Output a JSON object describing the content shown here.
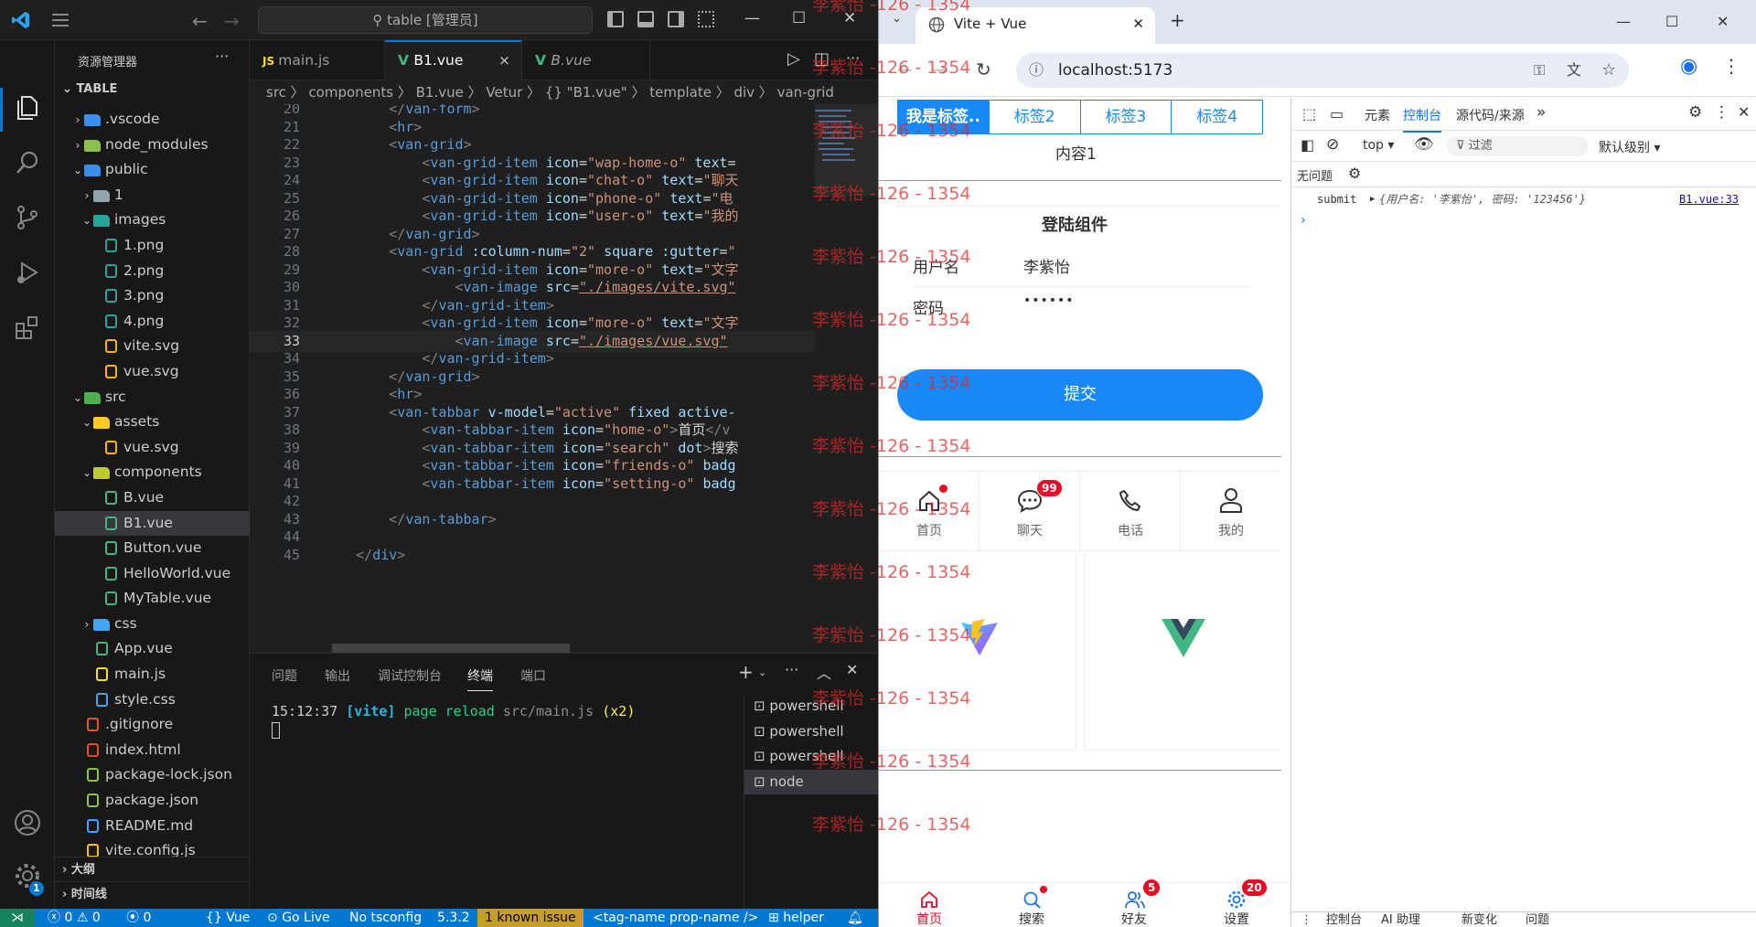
{
  "vscode": {
    "search": "table [管理员]",
    "sidebar": {
      "title": "资源管理器",
      "root": "TABLE",
      "tree": [
        {
          "label": ".vscode",
          "depth": 0,
          "type": "folder",
          "open": false,
          "icon": "vscode-folder-icon",
          "color": "#3b8eea"
        },
        {
          "label": "node_modules",
          "depth": 0,
          "type": "folder",
          "open": false,
          "icon": "node-folder-icon",
          "color": "#8bc34a"
        },
        {
          "label": "public",
          "depth": 0,
          "type": "folder",
          "open": true,
          "icon": "public-folder-icon",
          "color": "#3b8eea"
        },
        {
          "label": "1",
          "depth": 1,
          "type": "folder",
          "open": false,
          "icon": "folder-icon",
          "color": "#90a4ae"
        },
        {
          "label": "images",
          "depth": 1,
          "type": "folder",
          "open": true,
          "icon": "images-folder-icon",
          "color": "#26a69a"
        },
        {
          "label": "1.png",
          "depth": 2,
          "type": "file",
          "icon": "image-file-icon",
          "color": "#26a69a"
        },
        {
          "label": "2.png",
          "depth": 2,
          "type": "file",
          "icon": "image-file-icon",
          "color": "#26a69a"
        },
        {
          "label": "3.png",
          "depth": 2,
          "type": "file",
          "icon": "image-file-icon",
          "color": "#26a69a"
        },
        {
          "label": "4.png",
          "depth": 2,
          "type": "file",
          "icon": "image-file-icon",
          "color": "#26a69a"
        },
        {
          "label": "vite.svg",
          "depth": 2,
          "type": "file",
          "icon": "svg-file-icon",
          "color": "#ffb300"
        },
        {
          "label": "vue.svg",
          "depth": 2,
          "type": "file",
          "icon": "svg-file-icon",
          "color": "#ffb300"
        },
        {
          "label": "src",
          "depth": 0,
          "type": "folder",
          "open": true,
          "icon": "src-folder-icon",
          "color": "#4caf50"
        },
        {
          "label": "assets",
          "depth": 1,
          "type": "folder",
          "open": true,
          "icon": "assets-folder-icon",
          "color": "#ffca28"
        },
        {
          "label": "vue.svg",
          "depth": 2,
          "type": "file",
          "icon": "svg-file-icon",
          "color": "#ffb300"
        },
        {
          "label": "components",
          "depth": 1,
          "type": "folder",
          "open": true,
          "icon": "components-folder-icon",
          "color": "#c0ca33"
        },
        {
          "label": "B.vue",
          "depth": 2,
          "type": "file",
          "icon": "vue-file-icon",
          "color": "#41b883"
        },
        {
          "label": "B1.vue",
          "depth": 2,
          "type": "file",
          "icon": "vue-file-icon",
          "color": "#41b883",
          "selected": true
        },
        {
          "label": "Button.vue",
          "depth": 2,
          "type": "file",
          "icon": "vue-file-icon",
          "color": "#41b883"
        },
        {
          "label": "HelloWorld.vue",
          "depth": 2,
          "type": "file",
          "icon": "vue-file-icon",
          "color": "#41b883"
        },
        {
          "label": "MyTable.vue",
          "depth": 2,
          "type": "file",
          "icon": "vue-file-icon",
          "color": "#41b883"
        },
        {
          "label": "css",
          "depth": 1,
          "type": "folder",
          "open": false,
          "icon": "css-folder-icon",
          "color": "#42a5f5"
        },
        {
          "label": "App.vue",
          "depth": 1,
          "type": "file",
          "icon": "vue-file-icon",
          "color": "#41b883"
        },
        {
          "label": "main.js",
          "depth": 1,
          "type": "file",
          "icon": "js-file-icon",
          "color": "#f7df1e"
        },
        {
          "label": "style.css",
          "depth": 1,
          "type": "file",
          "icon": "css-file-icon",
          "color": "#42a5f5"
        },
        {
          "label": ".gitignore",
          "depth": 0,
          "type": "file",
          "icon": "git-file-icon",
          "color": "#f4511e"
        },
        {
          "label": "index.html",
          "depth": 0,
          "type": "file",
          "icon": "html-file-icon",
          "color": "#e44d26"
        },
        {
          "label": "package-lock.json",
          "depth": 0,
          "type": "file",
          "icon": "node-file-icon",
          "color": "#8bc34a"
        },
        {
          "label": "package.json",
          "depth": 0,
          "type": "file",
          "icon": "node-file-icon",
          "color": "#8bc34a"
        },
        {
          "label": "README.md",
          "depth": 0,
          "type": "file",
          "icon": "info-file-icon",
          "color": "#42a5f5"
        },
        {
          "label": "vite.config.js",
          "depth": 0,
          "type": "file",
          "icon": "vite-file-icon",
          "color": "#ffc107"
        }
      ],
      "outline": "大纲",
      "timeline": "时间线"
    },
    "tabs": [
      {
        "label": "main.js",
        "icon": "js-file-icon",
        "italic": false
      },
      {
        "label": "B1.vue",
        "icon": "vue-file-icon",
        "italic": false,
        "active": true,
        "close": "×"
      },
      {
        "label": "B.vue",
        "icon": "vue-file-icon",
        "italic": true
      }
    ],
    "breadcrumb": "src 〉 components 〉 B1.vue 〉 Vetur 〉 {} \"B1.vue\" 〉 template 〉 div 〉 van-grid",
    "code_lines": [
      {
        "n": "20",
        "html": "        <span class='br'>&lt;/</span><span class='tg'>van-form</span><span class='br'>&gt;</span>"
      },
      {
        "n": "21",
        "html": "        <span class='br'>&lt;</span><span class='tg'>hr</span><span class='br'>&gt;</span>"
      },
      {
        "n": "22",
        "html": "        <span class='br'>&lt;</span><span class='tg'>van-grid</span><span class='br'>&gt;</span>"
      },
      {
        "n": "23",
        "html": "            <span class='br'>&lt;</span><span class='tg'>van-grid-item</span> <span class='at'>icon</span><span class='tx'>=</span><span class='st'>\"wap-home-o\"</span> <span class='at'>text</span><span class='tx'>=</span>"
      },
      {
        "n": "24",
        "html": "            <span class='br'>&lt;</span><span class='tg'>van-grid-item</span> <span class='at'>icon</span><span class='tx'>=</span><span class='st'>\"chat-o\"</span> <span class='at'>text</span><span class='tx'>=</span><span class='st'>\"聊天</span>"
      },
      {
        "n": "25",
        "html": "            <span class='br'>&lt;</span><span class='tg'>van-grid-item</span> <span class='at'>icon</span><span class='tx'>=</span><span class='st'>\"phone-o\"</span> <span class='at'>text</span><span class='tx'>=</span><span class='st'>\"电</span>"
      },
      {
        "n": "26",
        "html": "            <span class='br'>&lt;</span><span class='tg'>van-grid-item</span> <span class='at'>icon</span><span class='tx'>=</span><span class='st'>\"user-o\"</span> <span class='at'>text</span><span class='tx'>=</span><span class='st'>\"我的</span>"
      },
      {
        "n": "27",
        "html": "        <span class='br'>&lt;/</span><span class='tg'>van-grid</span><span class='br'>&gt;</span>"
      },
      {
        "n": "28",
        "html": "        <span class='br'>&lt;</span><span class='tg'>van-grid</span> <span class='at'>:column-num</span><span class='tx'>=</span><span class='st'>\"2\"</span> <span class='at'>square</span> <span class='at'>:gutter</span><span class='tx'>=</span><span class='st'>\"</span>"
      },
      {
        "n": "29",
        "html": "            <span class='br'>&lt;</span><span class='tg'>van-grid-item</span> <span class='at'>icon</span><span class='tx'>=</span><span class='st'>\"more-o\"</span> <span class='at'>text</span><span class='tx'>=</span><span class='st'>\"文字</span>"
      },
      {
        "n": "30",
        "html": "                <span class='br'>&lt;</span><span class='tg'>van-image</span> <span class='at'>src</span><span class='tx'>=</span><span class='st un'>\"./images/vite.svg\"</span>"
      },
      {
        "n": "31",
        "html": "            <span class='br'>&lt;/</span><span class='tg'>van-grid-item</span><span class='br'>&gt;</span>"
      },
      {
        "n": "32",
        "html": "            <span class='br'>&lt;</span><span class='tg'>van-grid-item</span> <span class='at'>icon</span><span class='tx'>=</span><span class='st'>\"more-o\"</span> <span class='at'>text</span><span class='tx'>=</span><span class='st'>\"文字</span>"
      },
      {
        "n": "33",
        "html": "                <span class='br'>&lt;</span><span class='tg'>van-image</span> <span class='at'>src</span><span class='tx'>=</span><span class='st un'>\"./images/vue.svg\"</span>",
        "cur": true
      },
      {
        "n": "34",
        "html": "            <span class='br'>&lt;/</span><span class='tg'>van-grid-item</span><span class='br'>&gt;</span>"
      },
      {
        "n": "35",
        "html": "        <span class='br'>&lt;/</span><span class='tg'>van-grid</span><span class='br'>&gt;</span>"
      },
      {
        "n": "36",
        "html": "        <span class='br'>&lt;</span><span class='tg'>hr</span><span class='br'>&gt;</span>"
      },
      {
        "n": "37",
        "html": "        <span class='br'>&lt;</span><span class='tg'>van-tabbar</span> <span class='at'>v-model</span><span class='tx'>=</span><span class='st'>\"active\"</span> <span class='at'>fixed</span> <span class='at'>active-</span>"
      },
      {
        "n": "38",
        "html": "            <span class='br'>&lt;</span><span class='tg'>van-tabbar-item</span> <span class='at'>icon</span><span class='tx'>=</span><span class='st'>\"home-o\"</span><span class='br'>&gt;</span><span class='tx'>首页</span><span class='br'>&lt;/v</span>"
      },
      {
        "n": "39",
        "html": "            <span class='br'>&lt;</span><span class='tg'>van-tabbar-item</span> <span class='at'>icon</span><span class='tx'>=</span><span class='st'>\"search\"</span> <span class='at'>dot</span><span class='br'>&gt;</span><span class='tx'>搜索</span>"
      },
      {
        "n": "40",
        "html": "            <span class='br'>&lt;</span><span class='tg'>van-tabbar-item</span> <span class='at'>icon</span><span class='tx'>=</span><span class='st'>\"friends-o\"</span> <span class='at'>badg</span>"
      },
      {
        "n": "41",
        "html": "            <span class='br'>&lt;</span><span class='tg'>van-tabbar-item</span> <span class='at'>icon</span><span class='tx'>=</span><span class='st'>\"setting-o\"</span> <span class='at'>badg</span>"
      },
      {
        "n": "42",
        "html": ""
      },
      {
        "n": "43",
        "html": "        <span class='br'>&lt;/</span><span class='tg'>van-tabbar</span><span class='br'>&gt;</span>"
      },
      {
        "n": "44",
        "html": ""
      },
      {
        "n": "45",
        "html": "    <span class='br'>&lt;/</span><span class='tg'>div</span><span class='br'>&gt;</span>"
      }
    ],
    "panel": {
      "tabs": [
        "问题",
        "输出",
        "调试控制台",
        "终端",
        "端口"
      ],
      "active_tab": "终端",
      "terminal_time": "15:12:37",
      "terminal_tag": "[vite]",
      "terminal_msg": "page reload",
      "terminal_path": "src/main.js",
      "terminal_count": "(x2)",
      "terminals": [
        "powershell",
        "powershell",
        "powershell",
        "node"
      ]
    },
    "status": {
      "errors": "0",
      "warnings": "0",
      "ports": "0",
      "lang": "Vue",
      "golive": "Go Live",
      "tsconfig": "No tsconfig",
      "version": "5.3.2",
      "issue": "1 known issue",
      "tagname": "<tag-name prop-name />",
      "helper": "helper"
    },
    "accent": "#0078d4"
  },
  "browser": {
    "tab_title": "Vite + Vue",
    "url": "localhost:5173",
    "app": {
      "tabs": [
        "我是标签..",
        "标签2",
        "标签3",
        "标签4"
      ],
      "content": "内容1",
      "login_title": "登陆组件",
      "username_label": "用户名",
      "username_value": "李紫怡",
      "password_label": "密码",
      "password_value": "••••••",
      "submit": "提交",
      "grid": [
        {
          "label": "首页",
          "icon": "home-icon",
          "dot": true
        },
        {
          "label": "聊天",
          "icon": "chat-icon",
          "badge": "99"
        },
        {
          "label": "电话",
          "icon": "phone-icon"
        },
        {
          "label": "我的",
          "icon": "user-icon"
        }
      ],
      "tabbar": [
        {
          "label": "首页",
          "icon": "home-icon",
          "active": true
        },
        {
          "label": "搜索",
          "icon": "search-icon",
          "dot": true
        },
        {
          "label": "好友",
          "icon": "friends-icon",
          "badge": "5"
        },
        {
          "label": "设置",
          "icon": "setting-icon",
          "badge": "20"
        }
      ],
      "primary": "#1989fa",
      "danger": "#ee0a24"
    },
    "watermark": "李紫怡 -126 - 1354",
    "devtools": {
      "tabs": [
        "元素",
        "控制台",
        "源代码/来源"
      ],
      "active_tab": "控制台",
      "context": "top",
      "filter": "过滤",
      "level": "默认级别",
      "issues": "无问题",
      "log_prefix": "submit",
      "log_obj": "{用户名: '李紫怡', 密码: '123456'}",
      "log_src": "B1.vue:33",
      "drawer_tabs": [
        "控制台",
        "AI 助理",
        "新变化",
        "问题"
      ]
    }
  }
}
